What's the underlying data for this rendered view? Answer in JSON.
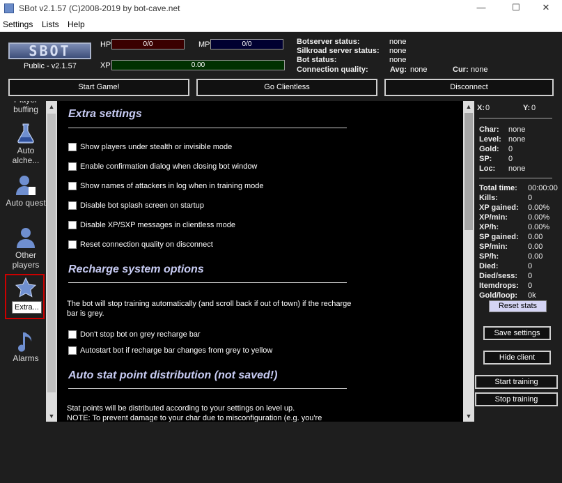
{
  "window": {
    "title": "SBot v2.1.57 (C)2008-2019 by bot-cave.net",
    "minimize": "—",
    "maximize": "☐",
    "close": "✕"
  },
  "menu": [
    "Settings",
    "Lists",
    "Help"
  ],
  "header": {
    "version": "Public - v2.1.57",
    "hp_label": "HP",
    "hp_value": "0/0",
    "mp_label": "MP",
    "mp_value": "0/0",
    "xp_label": "XP",
    "xp_value": "0.00",
    "botserver_label": "Botserver status:",
    "botserver_value": "none",
    "silkroad_label": "Silkroad server status:",
    "silkroad_value": "none",
    "botstatus_label": "Bot status:",
    "botstatus_value": "none",
    "conn_label": "Connection quality:",
    "avg_label": "Avg:",
    "avg_value": "none",
    "cur_label": "Cur:",
    "cur_value": "none",
    "colors": {
      "hp": "#3a0000",
      "mp": "#000030",
      "xp": "#003000"
    }
  },
  "buttons": {
    "start_game": "Start Game!",
    "go_clientless": "Go Clientless",
    "disconnect": "Disconnect"
  },
  "sidebar": [
    {
      "label": "Player buffing",
      "icon": "player-buffing-icon"
    },
    {
      "label": "Auto alche...",
      "icon": "flask-icon"
    },
    {
      "label": "Auto quest",
      "icon": "quest-user-icon"
    },
    {
      "label": "Other players",
      "icon": "users-icon"
    },
    {
      "label": "Extra...",
      "icon": "star-icon"
    },
    {
      "label": "Alarms",
      "icon": "music-note-icon"
    }
  ],
  "tooltip": "Extra...",
  "content": {
    "extra_title": "Extra settings",
    "extra_options": [
      "Show players under stealth or invisible mode",
      "Enable confirmation dialog when closing bot window",
      "Show names of attackers in log when in training mode",
      "Disable bot splash screen on startup",
      "Disable XP/SXP messages in clientless mode",
      "Reset connection quality on disconnect"
    ],
    "recharge_title": "Recharge system options",
    "recharge_text": "The bot will stop training automatically (and scroll back if out of town) if the recharge\nbar is grey.",
    "recharge_options": [
      "Don't stop bot on grey recharge bar",
      "Autostart bot if recharge bar changes from grey to yellow"
    ],
    "stat_title": "Auto stat point distribution (not saved!)",
    "stat_text": "Stat points will be distributed according to your settings on level up.\nNOTE: To prevent damage to your char due to misconfiguration (e.g. you're"
  },
  "right": {
    "x_label": "X:",
    "x_value": "0",
    "y_label": "Y:",
    "y_value": "0",
    "char_label": "Char:",
    "char_value": "none",
    "level_label": "Level:",
    "level_value": "none",
    "gold_label": "Gold:",
    "gold_value": "0",
    "sp_label": "SP:",
    "sp_value": "0",
    "loc_label": "Loc:",
    "loc_value": "none",
    "stats": [
      {
        "label": "Total time:",
        "value": "00:00:00"
      },
      {
        "label": "Kills:",
        "value": "0"
      },
      {
        "label": "XP gained:",
        "value": "0.00%"
      },
      {
        "label": "XP/min:",
        "value": "0.00%"
      },
      {
        "label": "XP/h:",
        "value": "0.00%"
      },
      {
        "label": "SP gained:",
        "value": "0.00"
      },
      {
        "label": "SP/min:",
        "value": "0.00"
      },
      {
        "label": "SP/h:",
        "value": "0.00"
      },
      {
        "label": "Died:",
        "value": "0"
      },
      {
        "label": "Died/sess:",
        "value": "0"
      },
      {
        "label": "Itemdrops:",
        "value": "0"
      },
      {
        "label": "Gold/loop:",
        "value": "0k"
      }
    ],
    "reset_stats": "Reset stats",
    "save_settings": "Save settings",
    "hide_client": "Hide client",
    "start_training": "Start training",
    "stop_training": "Stop training"
  },
  "scroll": {
    "up": "▲",
    "down": "▼"
  }
}
